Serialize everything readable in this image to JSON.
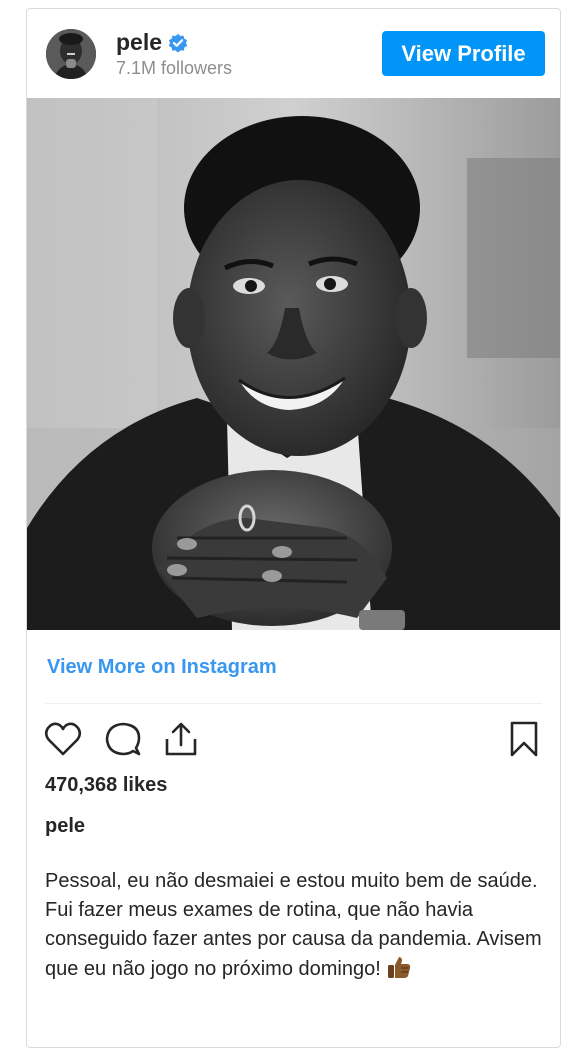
{
  "post": {
    "username": "pele",
    "followers": "7.1M followers",
    "view_profile_label": "View Profile",
    "view_more_label": "View More on Instagram",
    "likes": "470,368 likes",
    "caption_username": "pele",
    "caption_text": "Pessoal, eu não desmaiei e estou muito bem de saúde. Fui fazer meus exames de rotina, que não havia conseguido fazer antes por causa da pandemia. Avisem que eu não jogo no próximo domingo!",
    "photo_alt": "pele"
  },
  "icons": {
    "verified": "verified-badge-icon",
    "like": "heart-icon",
    "comment": "comment-bubble-icon",
    "share": "share-icon",
    "save": "bookmark-icon",
    "caption_emoji": "thumbs-up-icon"
  },
  "colors": {
    "accent": "#0095f6",
    "link": "#3897f0",
    "text": "#262626",
    "secondary_text": "#8e8e8e",
    "border": "#dbdbdb"
  }
}
